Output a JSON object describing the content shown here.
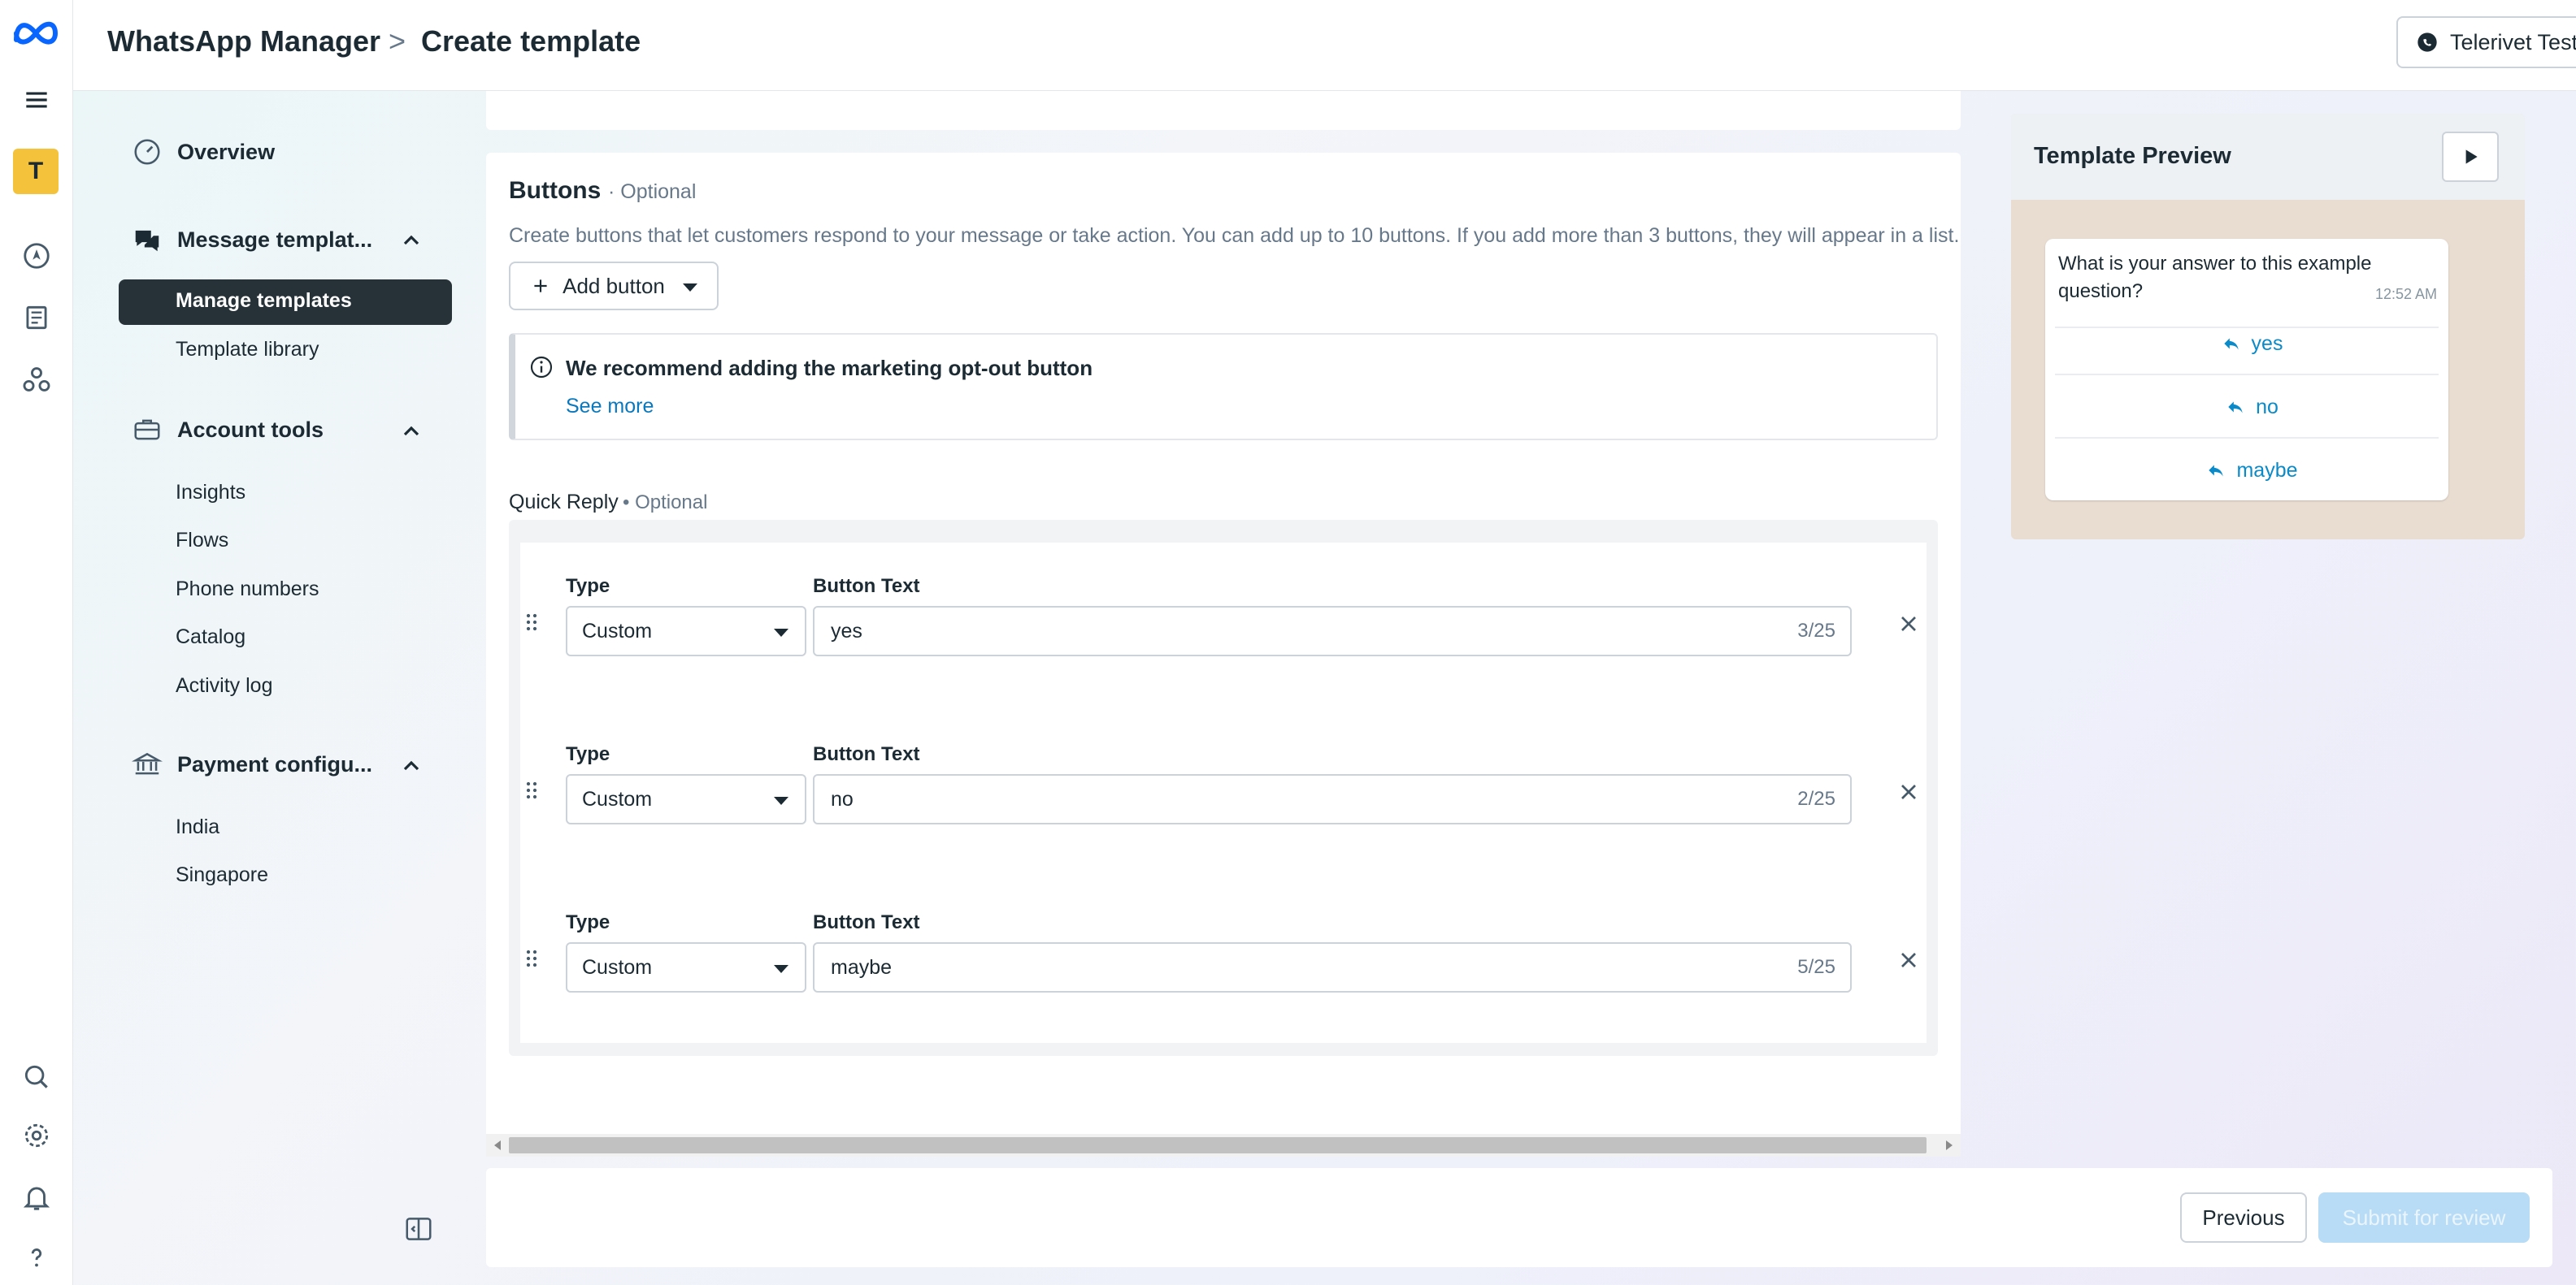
{
  "header": {
    "app_name": "WhatsApp Manager",
    "separator": ">",
    "page_title": "Create template",
    "account": "Telerivet Test"
  },
  "rail": {
    "avatar_letter": "T"
  },
  "sidebar": {
    "sections": [
      {
        "label": "Overview"
      },
      {
        "label": "Message templat...",
        "items": [
          "Manage templates",
          "Template library"
        ]
      },
      {
        "label": "Account tools",
        "items": [
          "Insights",
          "Flows",
          "Phone numbers",
          "Catalog",
          "Activity log"
        ]
      },
      {
        "label": "Payment configu...",
        "items": [
          "India",
          "Singapore"
        ]
      }
    ]
  },
  "buttons_section": {
    "title": "Buttons",
    "optional": "· Optional",
    "description": "Create buttons that let customers respond to your message or take action. You can add up to 10 buttons. If you add more than 3 buttons, they will appear in a list.",
    "add_button": "Add button",
    "notice_title": "We recommend adding the marketing opt-out button",
    "notice_link": "See more",
    "quick_reply_label": "Quick Reply",
    "quick_reply_optional": "• Optional",
    "type_label": "Type",
    "text_label": "Button Text",
    "rows": [
      {
        "type": "Custom",
        "text": "yes",
        "count": "3/25"
      },
      {
        "type": "Custom",
        "text": "no",
        "count": "2/25"
      },
      {
        "type": "Custom",
        "text": "maybe",
        "count": "5/25"
      }
    ]
  },
  "footer": {
    "previous": "Previous",
    "submit": "Submit for review"
  },
  "preview": {
    "title": "Template Preview",
    "message": "What is your answer to this example question?",
    "time": "12:52 AM",
    "replies": [
      "yes",
      "no",
      "maybe"
    ]
  },
  "colors": {
    "accent": "#0a8ac8",
    "nav_active": "#263238",
    "submit_disabled": "#b8dcf5",
    "avatar_bg": "#f5c33b"
  }
}
